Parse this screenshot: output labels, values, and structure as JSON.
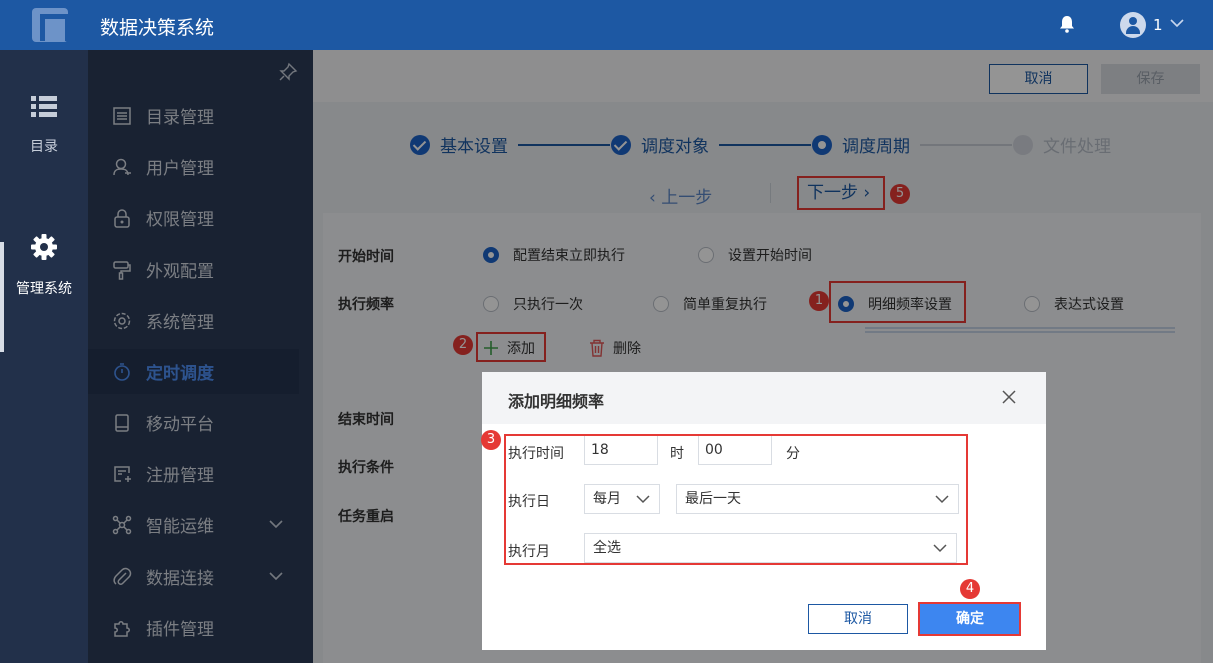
{
  "app": {
    "title": "数据决策系统"
  },
  "user": {
    "name": "1"
  },
  "rail": {
    "directory": "目录",
    "manage": "管理系统"
  },
  "sidebar": {
    "items": [
      {
        "label": "目录管理"
      },
      {
        "label": "用户管理"
      },
      {
        "label": "权限管理"
      },
      {
        "label": "外观配置"
      },
      {
        "label": "系统管理"
      },
      {
        "label": "定时调度"
      },
      {
        "label": "移动平台"
      },
      {
        "label": "注册管理"
      },
      {
        "label": "智能运维"
      },
      {
        "label": "数据连接"
      },
      {
        "label": "插件管理"
      }
    ]
  },
  "toolbar": {
    "cancel_label": "取消",
    "save_label": "保存"
  },
  "steps": [
    {
      "label": "基本设置"
    },
    {
      "label": "调度对象"
    },
    {
      "label": "调度周期"
    },
    {
      "label": "文件处理"
    }
  ],
  "nav": {
    "prev": "上一步",
    "next": "下一步"
  },
  "form": {
    "start_label": "开始时间",
    "start_opt1": "配置结束立即执行",
    "start_opt2": "设置开始时间",
    "freq_label": "执行频率",
    "freq_opt1": "只执行一次",
    "freq_opt2": "简单重复执行",
    "freq_opt3": "明细频率设置",
    "freq_opt4": "表达式设置",
    "add_label": "添加",
    "delete_label": "删除",
    "end_label": "结束时间",
    "cond_label": "执行条件",
    "restart_label": "任务重启"
  },
  "badges": {
    "b1": "1",
    "b2": "2",
    "b3": "3",
    "b4": "4",
    "b5": "5"
  },
  "modal": {
    "title": "添加明细频率",
    "time_label": "执行时间",
    "hour_value": "18",
    "hour_unit": "时",
    "minute_value": "00",
    "minute_unit": "分",
    "day_label": "执行日",
    "day_mode": "每月",
    "day_value": "最后一天",
    "month_label": "执行月",
    "month_value": "全选",
    "cancel_label": "取消",
    "ok_label": "确定"
  },
  "colors": {
    "header": "#1d58a3",
    "accent": "#1d62c8",
    "highlight": "#e53935",
    "primary_button": "#3d86f0"
  }
}
